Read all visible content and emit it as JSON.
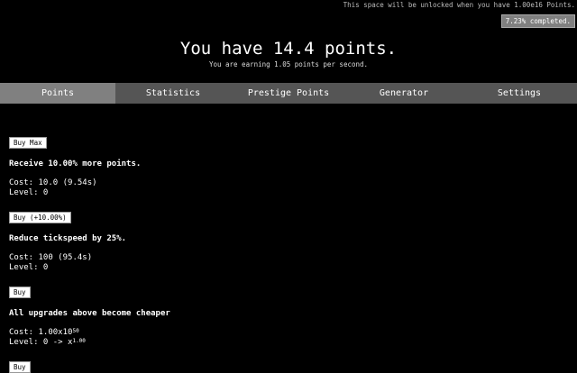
{
  "top": {
    "unlock_note": "This space will be unlocked when you have 1.00e16 Points.",
    "progress": "7.23% completed."
  },
  "header": {
    "title": "You have 14.4 points.",
    "earning": "You are earning 1.05 points per second."
  },
  "tabs": [
    {
      "label": "Points",
      "active": true
    },
    {
      "label": "Statistics",
      "active": false
    },
    {
      "label": "Prestige Points",
      "active": false
    },
    {
      "label": "Generator",
      "active": false
    },
    {
      "label": "Settings",
      "active": false
    }
  ],
  "buy_max_label": "Buy Max",
  "upgrades": [
    {
      "title": "Receive 10.00% more points.",
      "cost": "Cost: 10.0 (9.54s)",
      "level": "Level: 0",
      "button": "Buy (+10.00%)"
    },
    {
      "title": "Reduce tickspeed by 25%.",
      "cost": "Cost: 100 (95.4s)",
      "level": "Level: 0",
      "button": "Buy"
    },
    {
      "title": "All upgrades above become cheaper",
      "cost_prefix": "Cost: 1.00x10",
      "cost_exp": "50",
      "level_prefix": "Level: 0 -> x",
      "level_exp": "1.00",
      "button": "Buy"
    }
  ],
  "colors": {
    "background": "#000000",
    "tab_bar": "#555555",
    "tab_active": "#808080",
    "text": "#ffffff"
  }
}
